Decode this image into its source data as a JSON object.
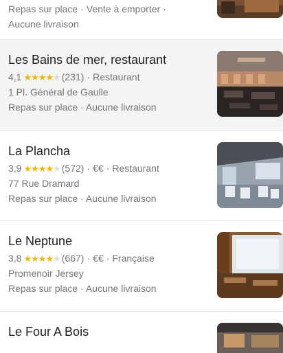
{
  "cards": [
    {
      "services": [
        "Repas sur place",
        "Vente à emporter",
        ""
      ],
      "services2": "Aucune livraison"
    },
    {
      "name": "Les Bains de mer, restaurant",
      "rating": "4,1",
      "stars": 4,
      "reviews": "(231)",
      "category": "Restaurant",
      "address": "1 Pl. Général de Gaulle",
      "services": "Repas sur place · Aucune livraison"
    },
    {
      "name": "La Plancha",
      "rating": "3,9",
      "stars": 4,
      "reviews": "(572)",
      "price": "€€",
      "category": "Restaurant",
      "address": "77 Rue Dramard",
      "services": "Repas sur place · Aucune livraison"
    },
    {
      "name": "Le Neptune",
      "rating": "3,8",
      "stars": 4,
      "reviews": "(667)",
      "price": "€€",
      "category": "Française",
      "address": "Promenoir Jersey",
      "services": "Repas sur place · Aucune livraison"
    },
    {
      "name": "Le Four A Bois"
    }
  ],
  "ui": {
    "separator": "·",
    "star_char": "★"
  }
}
